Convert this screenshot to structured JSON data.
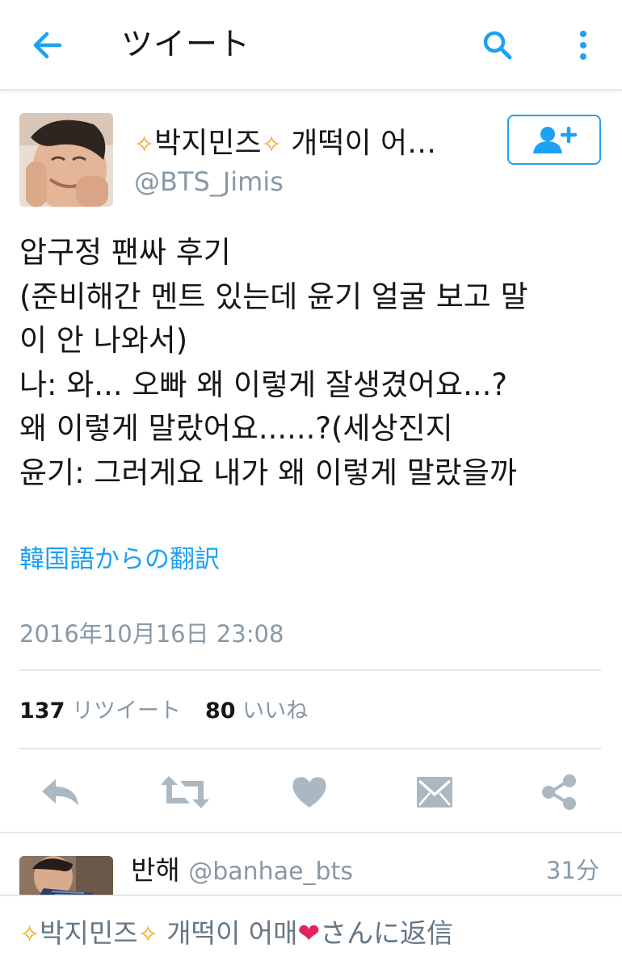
{
  "app_bar": {
    "title": "ツイート"
  },
  "tweet": {
    "display_name": {
      "spark_left": "✧",
      "name": "박지민즈",
      "spark_right": "✧",
      "suffix": " 개떡이 어…"
    },
    "handle": "@BTS_Jimis",
    "text_lines": [
      "압구정 팬싸 후기",
      "(준비해간 멘트 있는데 윤기 얼굴 보고 말",
      "이 안 나와서)",
      "나: 와... 오빠 왜 이렇게 잘생겼어요...?",
      "왜 이렇게 말랐어요......?(세상진지",
      "윤기: 그러게요 내가 왜 이렇게 말랐을까"
    ],
    "translate_label": "韓国語からの翻訳",
    "timestamp": "2016年10月16日 23:08",
    "retweets": {
      "count": "137",
      "label": "リツイート"
    },
    "likes": {
      "count": "80",
      "label": "いいね"
    }
  },
  "reply": {
    "name": "반해",
    "handle": "@banhae_bts",
    "time": "31分"
  },
  "compose": {
    "spark_left": "✧",
    "name": "박지민즈",
    "spark_right": "✧",
    "suffix": " 개떡이 어매",
    "emoji": "❤",
    "after": "さんに返信"
  },
  "colors": {
    "accent": "#1da1f2",
    "secondary_text": "#8899a6",
    "icon_gray": "#aab8c2",
    "primary_text": "#14171a",
    "spark": "#f5a623",
    "heart_emoji": "#e0245e"
  },
  "icons": {
    "back": "arrow-left-icon",
    "search": "search-icon",
    "more": "more-vertical-icon",
    "follow": "follow-user-plus-icon",
    "reply": "reply-icon",
    "retweet": "retweet-icon",
    "like": "heart-icon",
    "dm": "envelope-icon",
    "share": "share-icon"
  }
}
